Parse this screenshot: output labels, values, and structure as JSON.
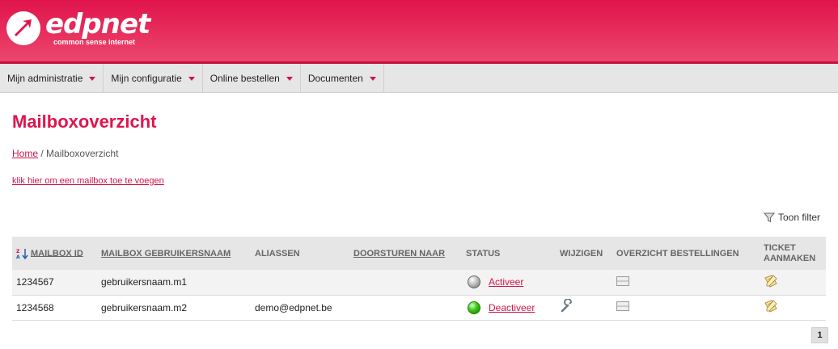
{
  "brand": {
    "name": "edpnet",
    "tagline": "common sense internet",
    "accent": "#e0144c"
  },
  "nav": [
    {
      "label": "Mijn administratie"
    },
    {
      "label": "Mijn configuratie"
    },
    {
      "label": "Online bestellen"
    },
    {
      "label": "Documenten"
    }
  ],
  "page": {
    "title": "Mailboxoverzicht",
    "breadcrumb": {
      "home": "Home",
      "separator": "/",
      "current": "Mailboxoverzicht"
    },
    "add_link": "klik hier om een mailbox toe te voegen",
    "filter_label": "Toon filter"
  },
  "table": {
    "headers": {
      "id": "MAILBOX ID",
      "username": "MAILBOX GEBRUIKERSNAAM",
      "aliases": "ALIASSEN",
      "forward": "DOORSTUREN NAAR",
      "status": "STATUS",
      "edit": "WIJZIGEN",
      "orders": "OVERZICHT BESTELLINGEN",
      "ticket_line1": "TICKET",
      "ticket_line2": "AANMAKEN"
    },
    "rows": [
      {
        "id": "1234567",
        "username": "gebruikersnaam.m1",
        "alias": "",
        "forward": "",
        "status": "inactive",
        "action": "Activeer",
        "editable": false
      },
      {
        "id": "1234568",
        "username": "gebruikersnaam.m2",
        "alias": "demo@edpnet.be",
        "forward": "",
        "status": "active",
        "action": "Deactiveer",
        "editable": true
      }
    ]
  },
  "pagination": {
    "current": "1"
  }
}
